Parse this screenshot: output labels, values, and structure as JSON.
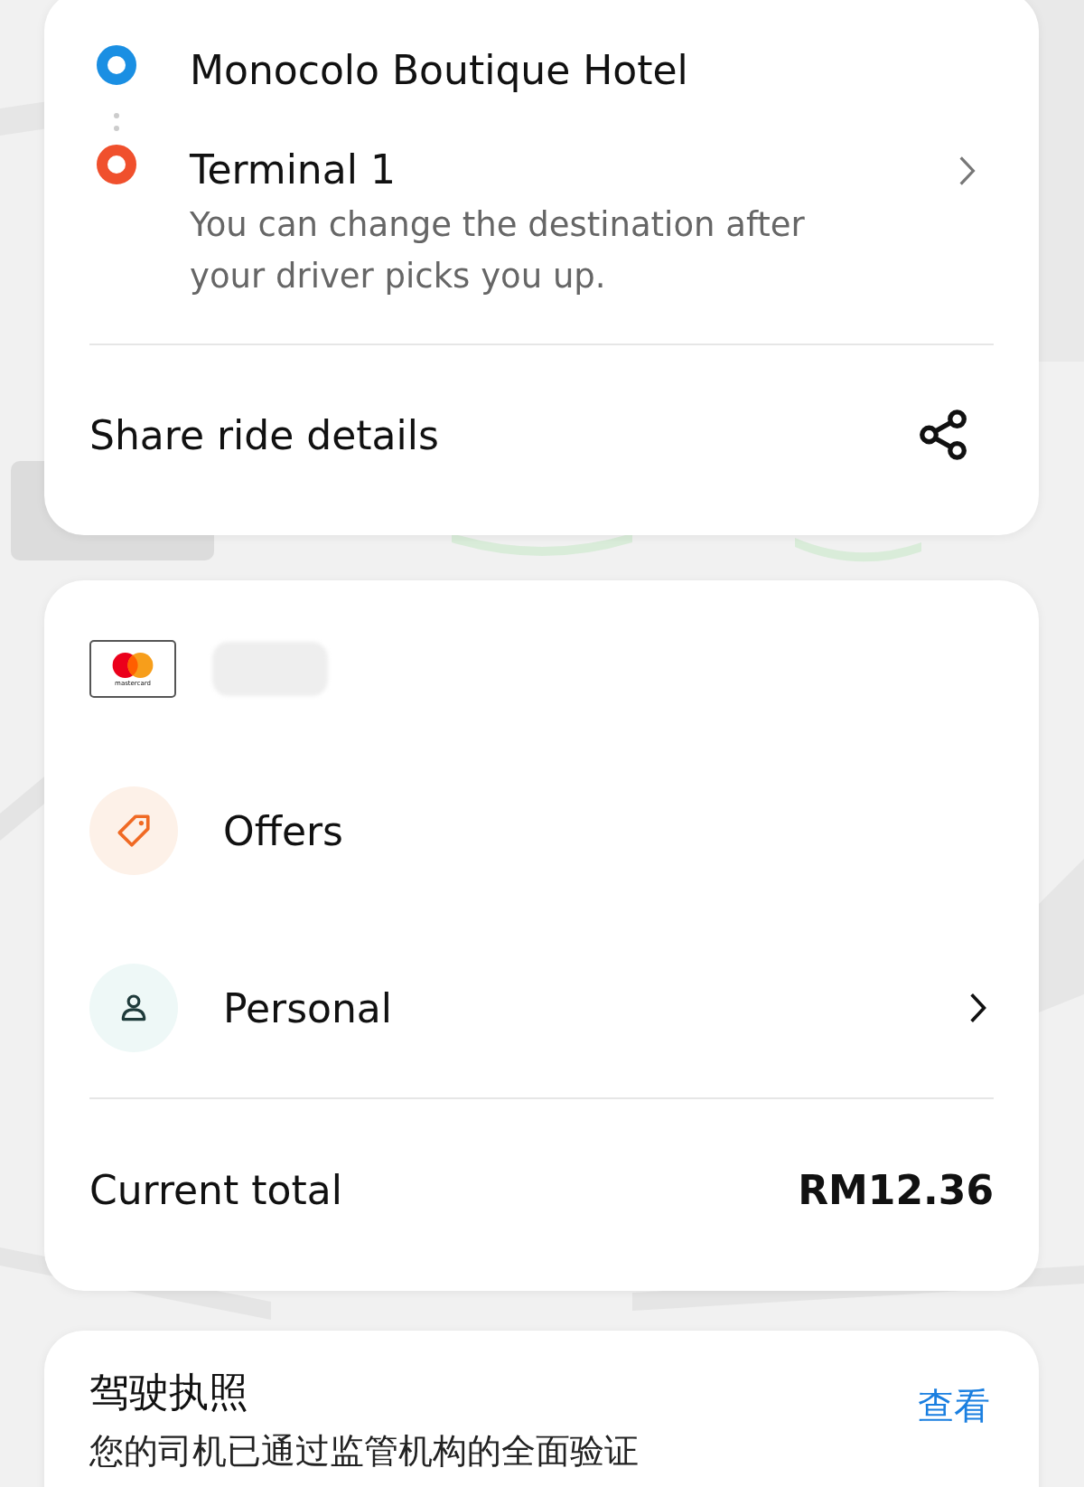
{
  "trip": {
    "pickup": "Monocolo Boutique Hotel",
    "destination": "Terminal 1",
    "destination_note": "You can change the destination after your driver picks you up.",
    "share_label": "Share ride details"
  },
  "payment": {
    "card_logo_text": "mastercard"
  },
  "options": [
    {
      "kind": "offers",
      "label": "Offers",
      "chevron": false
    },
    {
      "kind": "personal",
      "label": "Personal",
      "chevron": true
    }
  ],
  "total": {
    "label": "Current total",
    "amount": "RM12.36"
  },
  "license": {
    "title": "驾驶执照",
    "link": "查看",
    "note": "您的司机已通过监管机构的全面验证"
  }
}
